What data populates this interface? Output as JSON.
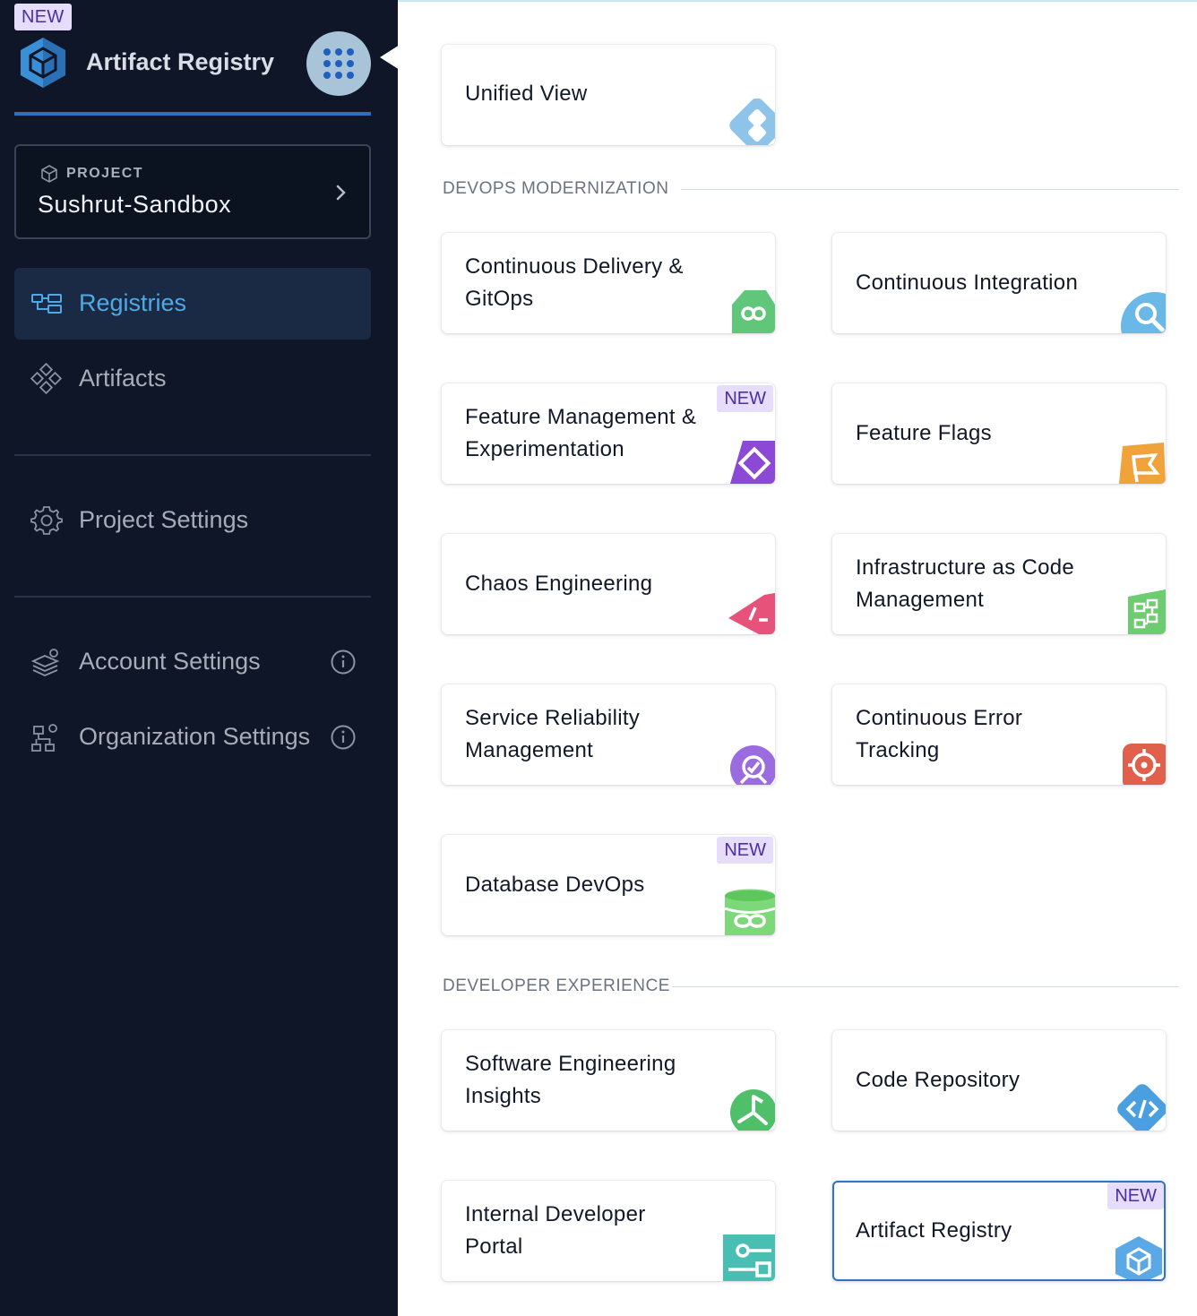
{
  "sidebar": {
    "new_badge": "NEW",
    "module_title": "Artifact Registry",
    "project": {
      "label": "PROJECT",
      "name": "Sushrut-Sandbox"
    },
    "nav": {
      "registries": "Registries",
      "artifacts": "Artifacts",
      "project_settings": "Project Settings",
      "account_settings": "Account Settings",
      "organization_settings": "Organization Settings"
    }
  },
  "main": {
    "new_badge": "NEW",
    "unified_view": "Unified View",
    "section_devops": "DEVOPS MODERNIZATION",
    "section_devex": "DEVELOPER EXPERIENCE",
    "cards": {
      "cd_line1": "Continuous Delivery &",
      "cd_line2": "GitOps",
      "ci": "Continuous Integration",
      "fme_line1": "Feature Management &",
      "fme_line2": "Experimentation",
      "ff": "Feature Flags",
      "chaos": "Chaos Engineering",
      "iacm_line1": "Infrastructure as Code",
      "iacm_line2": "Management",
      "srm_line1": "Service Reliability",
      "srm_line2": "Management",
      "cet_line1": "Continuous Error",
      "cet_line2": "Tracking",
      "dbdevops": "Database DevOps",
      "sei_line1": "Software Engineering",
      "sei_line2": "Insights",
      "code": "Code Repository",
      "idp_line1": "Internal Developer",
      "idp_line2": "Portal",
      "ar": "Artifact Registry"
    }
  },
  "colors": {
    "sidebar_bg": "#0e1627",
    "accent_active": "#4ea9e6",
    "new_badge_bg": "#e6dcfb",
    "selected_border": "#2f74c8"
  }
}
